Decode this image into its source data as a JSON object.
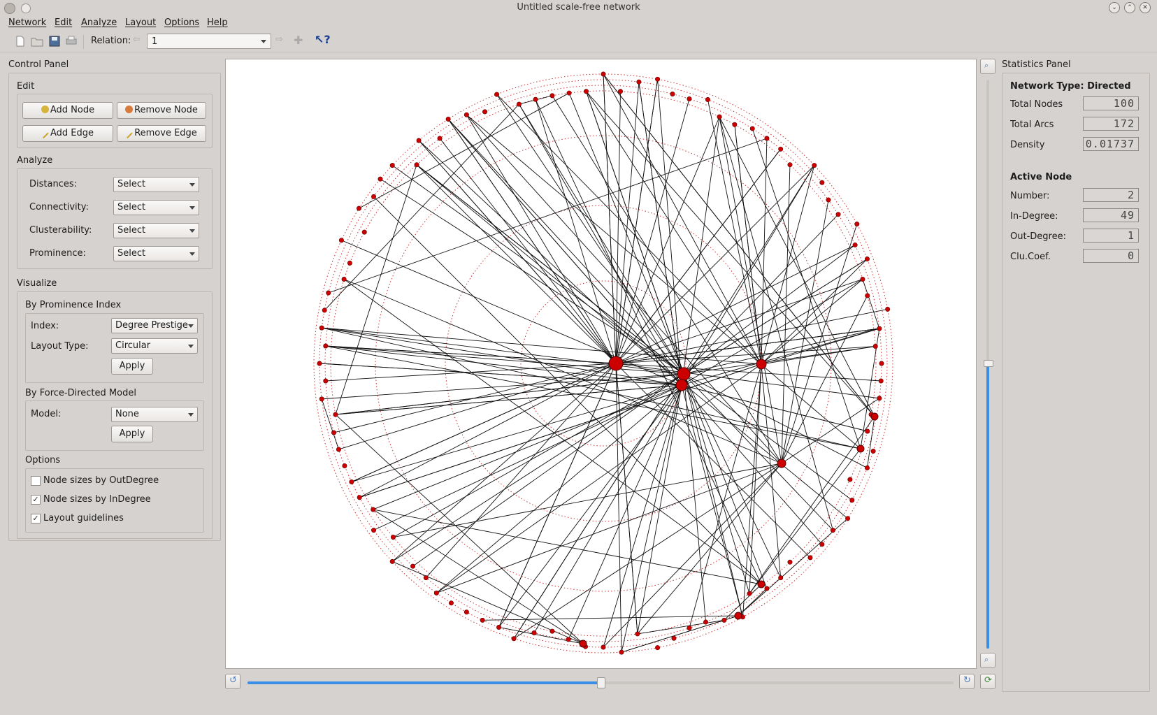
{
  "window": {
    "title": "Untitled scale-free network"
  },
  "menu": [
    "Network",
    "Edit",
    "Analyze",
    "Layout",
    "Options",
    "Help"
  ],
  "toolbar": {
    "relation_label": "Relation:",
    "relation_value": "1"
  },
  "control_panel": {
    "title": "Control Panel",
    "edit": {
      "title": "Edit",
      "add_node": "Add Node",
      "remove_node": "Remove Node",
      "add_edge": "Add Edge",
      "remove_edge": "Remove Edge"
    },
    "analyze": {
      "title": "Analyze",
      "rows": [
        {
          "label": "Distances:",
          "value": "Select"
        },
        {
          "label": "Connectivity:",
          "value": "Select"
        },
        {
          "label": "Clusterability:",
          "value": "Select"
        },
        {
          "label": "Prominence:",
          "value": "Select"
        }
      ]
    },
    "visualize": {
      "title": "Visualize",
      "prominence": {
        "title": "By Prominence Index",
        "index_label": "Index:",
        "index_value": "Degree Prestige",
        "layout_label": "Layout Type:",
        "layout_value": "Circular",
        "apply": "Apply"
      },
      "force": {
        "title": "By Force-Directed Model",
        "model_label": "Model:",
        "model_value": "None",
        "apply": "Apply"
      },
      "options": {
        "title": "Options",
        "items": [
          {
            "label": "Node sizes by OutDegree",
            "checked": false,
            "mark": ""
          },
          {
            "label": "Node sizes by InDegree",
            "checked": true,
            "mark": "✓"
          },
          {
            "label": "Layout guidelines",
            "checked": true,
            "mark": "✓"
          }
        ]
      }
    }
  },
  "stats": {
    "title": "Statistics Panel",
    "network_type": "Network Type: Directed",
    "total_nodes_label": "Total Nodes",
    "total_nodes": "100",
    "total_arcs_label": "Total Arcs",
    "total_arcs": "172",
    "density_label": "Density",
    "density": "0.01737",
    "active_title": "Active Node",
    "number_label": "Number:",
    "number": "2",
    "indegree_label": "In-Degree:",
    "indegree": "49",
    "outdegree_label": "Out-Degree:",
    "outdegree": "1",
    "clucoef_label": "Clu.Coef.",
    "clucoef": "0"
  },
  "colors": {
    "node": "#cc0000",
    "edge": "#111111",
    "guide": "#cc3333",
    "slider": "#3a8ee6"
  },
  "sliders": {
    "zoom_level": 0.5,
    "rotation_level": 0.5
  }
}
